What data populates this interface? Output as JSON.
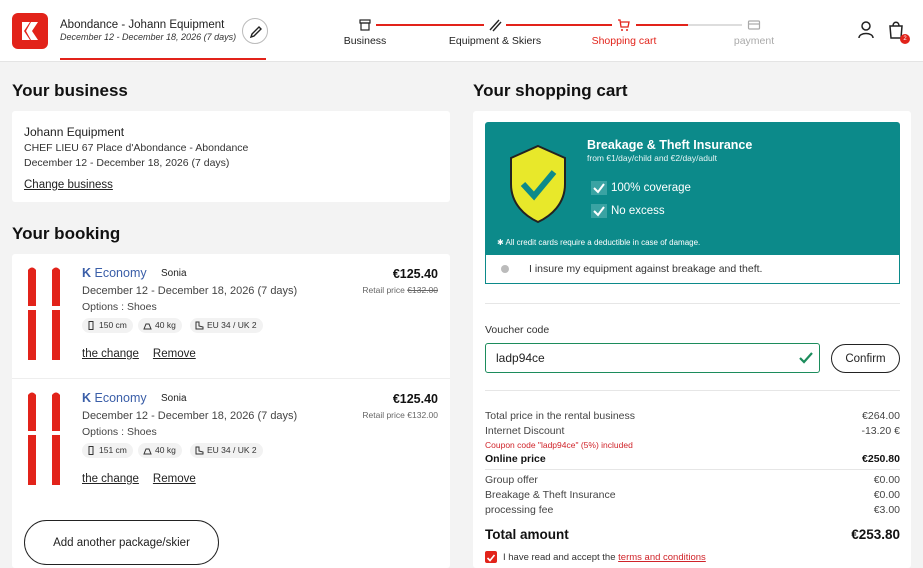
{
  "colors": {
    "brand": "#e2231a",
    "teal": "#0c8a8a",
    "link_blue": "#3a5ea8",
    "success": "#1c8c5c"
  },
  "header": {
    "shop_name": "Abondance - Johann Equipment",
    "shop_dates": "December 12 - December 18, 2026 (7 days)",
    "steps": [
      {
        "label": "Business",
        "icon": "store-icon",
        "state": "done"
      },
      {
        "label": "Equipment & Skiers",
        "icon": "skis-icon",
        "state": "done"
      },
      {
        "label": "Shopping cart",
        "icon": "cart-icon",
        "state": "active"
      },
      {
        "label": "payment",
        "icon": "card-icon",
        "state": "pending"
      }
    ],
    "cart_count": "2"
  },
  "business": {
    "heading": "Your business",
    "name": "Johann Equipment",
    "address": "CHEF LIEU 67 Place d'Abondance - Abondance",
    "dates": "December 12 - December 18, 2026 (7 days)",
    "change_label": "Change business"
  },
  "booking": {
    "heading": "Your booking",
    "items": [
      {
        "package_prefix": "K",
        "package": "Economy",
        "skier": "Sonia",
        "dates": "December 12 - December 18, 2026 (7 days)",
        "options": "Options : Shoes",
        "height": "150 cm",
        "weight": "40 kg",
        "shoe": "EU 34 / UK 2",
        "price": "€125.40",
        "retail_label": "Retail price",
        "retail_price": "€132.00",
        "change_label": "the change",
        "remove_label": "Remove"
      },
      {
        "package_prefix": "K",
        "package": "Economy",
        "skier": "Sonia",
        "dates": "December 12 - December 18, 2026 (7 days)",
        "options": "Options : Shoes",
        "height": "151 cm",
        "weight": "40 kg",
        "shoe": "EU 34 / UK 2",
        "price": "€125.40",
        "retail_label": "Retail price",
        "retail_price": "€132.00",
        "change_label": "the change",
        "remove_label": "Remove"
      }
    ],
    "add_label": "Add another package/skier"
  },
  "cart": {
    "heading": "Your shopping cart",
    "insurance": {
      "title": "Breakage & Theft Insurance",
      "subtitle": "from €1/day/child and €2/day/adult",
      "points": [
        "100% coverage",
        "No excess"
      ],
      "note": "All credit cards require a deductible in case of damage.",
      "toggle_label": "I insure my equipment against breakage and theft."
    },
    "voucher": {
      "label": "Voucher code",
      "value": "ladp94ce",
      "confirm_label": "Confirm"
    },
    "summary": [
      {
        "label": "Total price in the rental business",
        "value": "€264.00"
      },
      {
        "label": "Internet Discount",
        "value": "-13.20 €"
      },
      {
        "label": "Online price",
        "value": "€250.80"
      },
      {
        "label": "Group offer",
        "value": "€0.00"
      },
      {
        "label": "Breakage & Theft Insurance",
        "value": "€0.00"
      },
      {
        "label": "processing fee",
        "value": "€3.00"
      }
    ],
    "coupon_note": "Coupon code \"ladp94ce\" (5%) included",
    "total_label": "Total amount",
    "total_value": "€253.80",
    "terms_prefix": "I have read and accept the",
    "terms_link": "terms and conditions"
  }
}
